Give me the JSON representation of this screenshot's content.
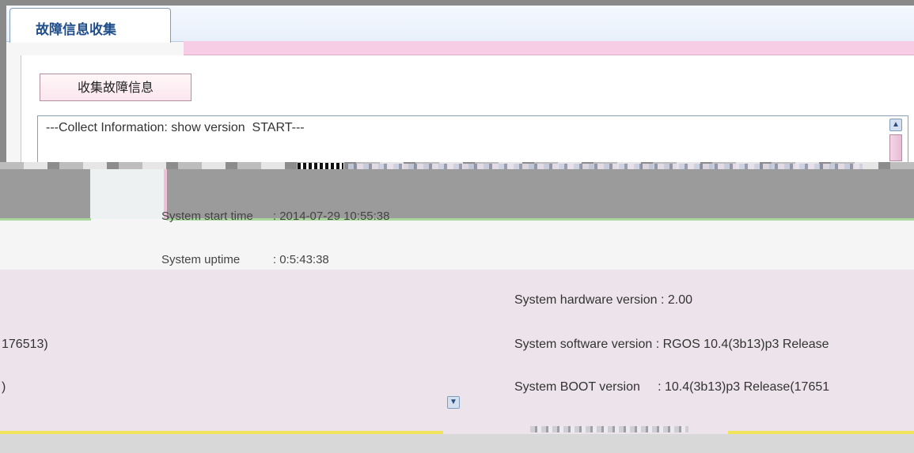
{
  "tab": {
    "label": "故障信息收集"
  },
  "toolbar": {
    "collect_label": "收集故障信息"
  },
  "log": {
    "first_line": "---Collect Information: show version  START---",
    "system_start_time": "System start time      : 2014-07-29 10:55:38",
    "system_uptime": "System uptime          : 0:5:43:38",
    "right_lines": [
      "System hardware version : 2.00",
      "System software version : RGOS 10.4(3b13)p3 Release",
      "System BOOT version     : 10.4(3b13)p3 Release(17651"
    ],
    "left_fragments": [
      "176513)",
      ")"
    ]
  },
  "icons": {
    "scroll_up": "▲",
    "scroll_down": "▼"
  },
  "colors": {
    "tab_text": "#1f4e8c",
    "pink_bar": "#f6cde4",
    "green_line": "#a8d89c",
    "yellow_line": "#f1e45a"
  }
}
